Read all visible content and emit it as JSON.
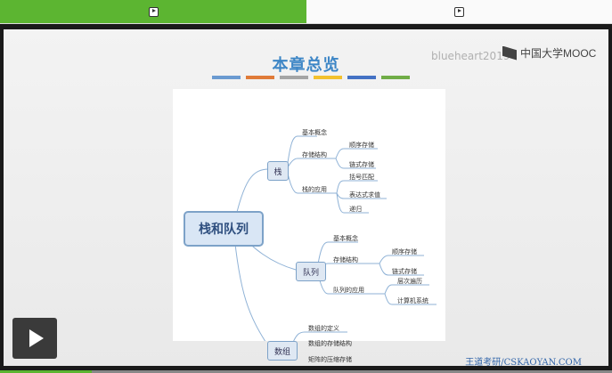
{
  "tabs": [
    {
      "icon": "video-play-icon",
      "active": true
    },
    {
      "icon": "video-play-icon",
      "active": false
    }
  ],
  "slide": {
    "title": "本章总览",
    "watermark": "blueheart2019",
    "brand": "中国大学MOOC",
    "color_bars": [
      "#6b9bd1",
      "#e07b39",
      "#a5a5a5",
      "#f2c12e",
      "#4472c4",
      "#70ad47"
    ]
  },
  "mindmap": {
    "root": "栈和队列",
    "stack": {
      "label": "栈",
      "basic": "基本概念",
      "storage": "存储结构",
      "seq": "顺序存储",
      "linked": "链式存储",
      "apps": "栈的应用",
      "bracket": "括号匹配",
      "expr": "表达式求值",
      "recursion": "递归"
    },
    "queue": {
      "label": "队列",
      "basic": "基本概念",
      "storage": "存储结构",
      "seq": "顺序存储",
      "linked": "链式存储",
      "apps": "队列的应用",
      "level": "层次遍历",
      "system": "计算机系统"
    },
    "array": {
      "label": "数组",
      "def": "数组的定义",
      "storage": "数组的存储结构",
      "compress": "矩阵的压缩存储"
    }
  },
  "footer": {
    "site": "王道考研/CSKAOYAN.COM",
    "progress": 0.15
  }
}
